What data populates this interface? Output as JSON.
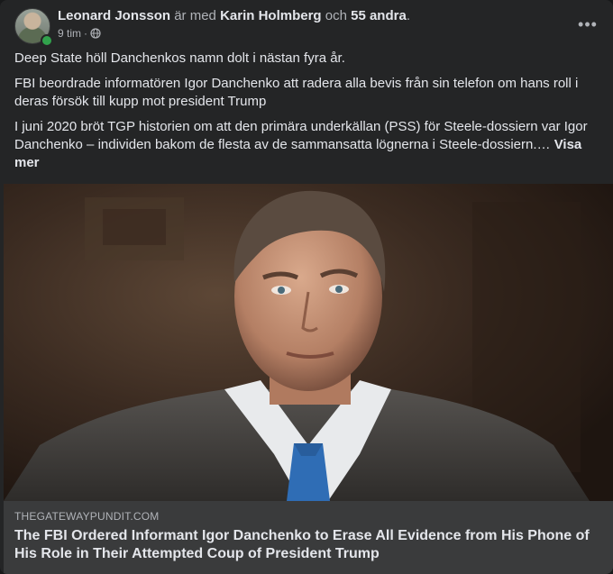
{
  "post": {
    "author": "Leonard Jonsson",
    "with_text": " är med ",
    "tagged_person": "Karin Holmberg",
    "and_text": " och ",
    "others": "55 andra",
    "end": ".",
    "time": "9 tim",
    "separator": "·",
    "privacy_icon": "globe-icon",
    "more_icon": "more-options-icon",
    "more_glyph": "•••"
  },
  "text": {
    "p1": "Deep State höll Danchenkos namn dolt i nästan fyra år.",
    "p2": "FBI beordrade informatören Igor Danchenko att radera alla bevis från sin telefon om hans roll i deras försök till kupp mot president Trump",
    "p3": "I juni 2020 bröt TGP historien om att den primära underkällan (PSS) för Steele-dossiern var Igor Danchenko – individen bakom de flesta av de sammansatta lögnerna i Steele-dossiern.…",
    "see_more": "Visa mer"
  },
  "link": {
    "domain": "THEGATEWAYPUNDIT.COM",
    "title": "The FBI Ordered Informant Igor Danchenko to Erase All Evidence from His Phone of His Role in Their Attempted Coup of President Trump"
  },
  "colors": {
    "card_bg": "#242526",
    "link_bg": "#3a3b3c",
    "online": "#31a24c",
    "tie": "#2f6db5"
  }
}
